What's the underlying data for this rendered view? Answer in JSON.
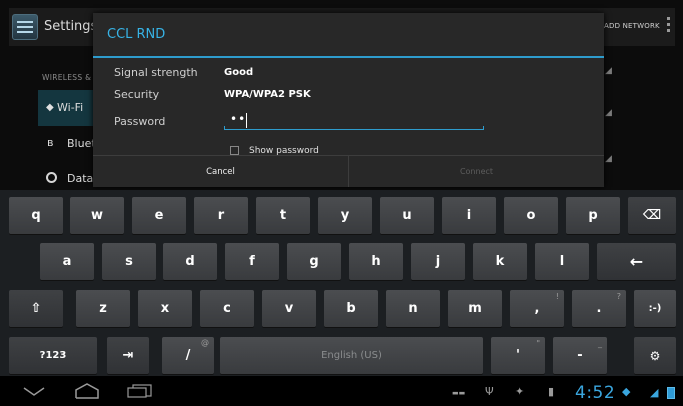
{
  "settings": {
    "title": "Settings",
    "add_network": "ADD NETWORK",
    "section_header": "WIRELESS & NETWORKS",
    "items": [
      {
        "label": "Wi-Fi"
      },
      {
        "label": "Bluetooth"
      },
      {
        "label": "Data usage"
      }
    ]
  },
  "dialog": {
    "title": "CCL RND",
    "signal_label": "Signal strength",
    "signal_value": "Good",
    "security_label": "Security",
    "security_value": "WPA/WPA2 PSK",
    "password_label": "Password",
    "password_value": "••",
    "show_password_label": "Show password",
    "cancel_label": "Cancel",
    "connect_label": "Connect"
  },
  "keyboard": {
    "row1": [
      "q",
      "w",
      "e",
      "r",
      "t",
      "y",
      "u",
      "i",
      "o",
      "p"
    ],
    "row2": [
      "a",
      "s",
      "d",
      "f",
      "g",
      "h",
      "j",
      "k",
      "l"
    ],
    "row3": [
      "z",
      "x",
      "c",
      "v",
      "b",
      "n",
      "m",
      ",",
      "."
    ],
    "row3_hints": [
      "",
      "",
      "",
      "",
      "",
      "",
      "",
      "!",
      "?"
    ],
    "symbols_label": "?123",
    "tab_label": "⇥",
    "slash_label": "/",
    "slash_hint": "@",
    "space_label": "English (US)",
    "apostrophe_label": "'",
    "apostrophe_hint": "\"",
    "dash_label": "-",
    "dash_hint": "_",
    "smiley_label": ":-)",
    "settings_label": "⚙",
    "backspace_label": "⌫",
    "enter_label": "←",
    "shift_label": "⇧"
  },
  "status": {
    "time": "4:52"
  },
  "colors": {
    "accent": "#33b5e5",
    "dialog_bg": "#282828",
    "key_bg": "#44464a"
  }
}
